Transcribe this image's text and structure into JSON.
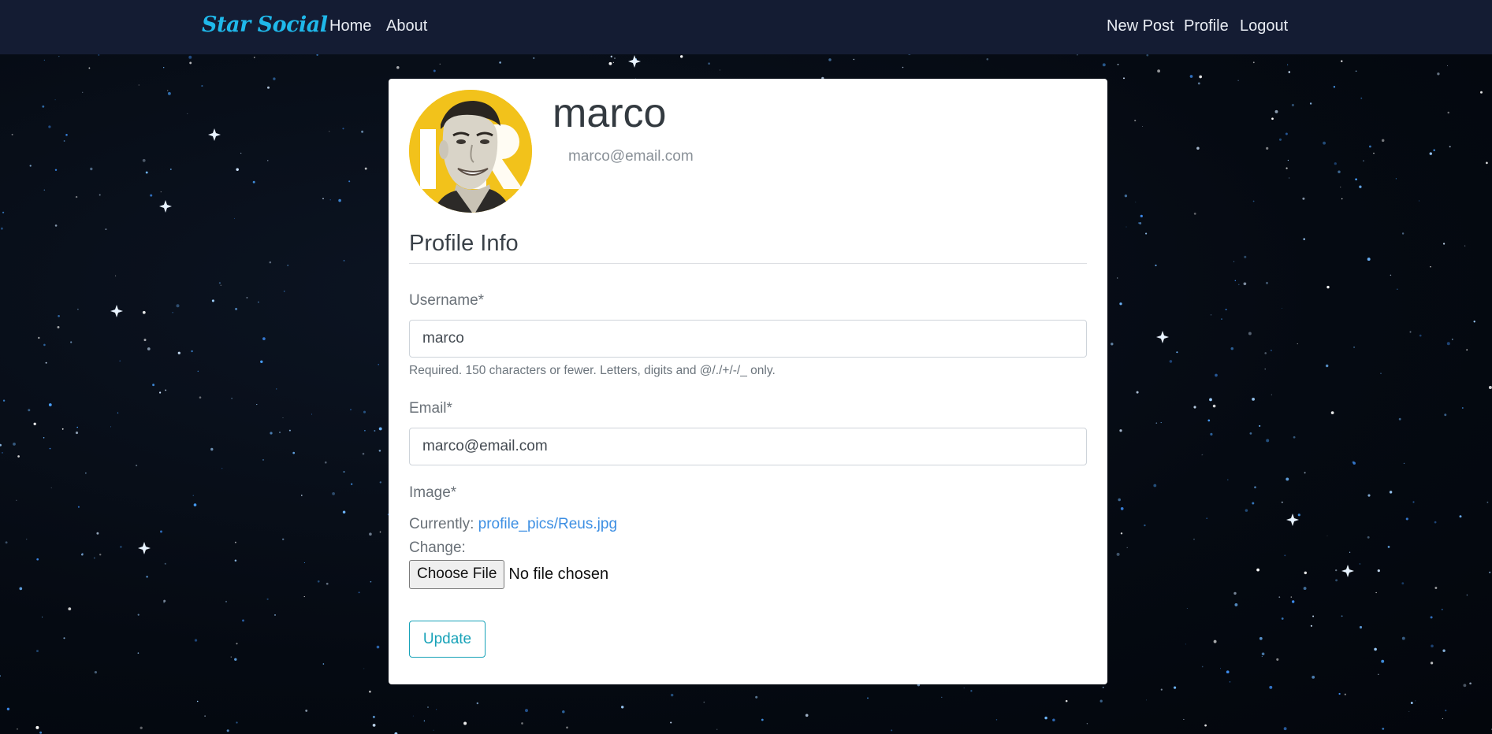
{
  "navbar": {
    "brand": "Star Social",
    "left_links": [
      "Home",
      "About"
    ],
    "right_links": [
      "New Post",
      "Profile",
      "Logout"
    ]
  },
  "profile": {
    "username": "marco",
    "email": "marco@email.com"
  },
  "form": {
    "section_title": "Profile Info",
    "username_label": "Username*",
    "username_value": "marco",
    "username_help": "Required. 150 characters or fewer. Letters, digits and @/./+/-/_ only.",
    "email_label": "Email*",
    "email_value": "marco@email.com",
    "image_label": "Image*",
    "currently_label": "Currently:",
    "current_image": "profile_pics/Reus.jpg",
    "change_label": "Change:",
    "file_button": "Choose File",
    "file_status": "No file chosen",
    "submit_label": "Update"
  },
  "colors": {
    "navbar_bg": "#141c33",
    "brand": "#1fb8ea",
    "accent": "#17a2b8",
    "link": "#3d8fe3",
    "avatar_bg": "#f2c21b"
  },
  "icons": {
    "avatar": "profile-photo",
    "background": "starry-night-sky"
  }
}
